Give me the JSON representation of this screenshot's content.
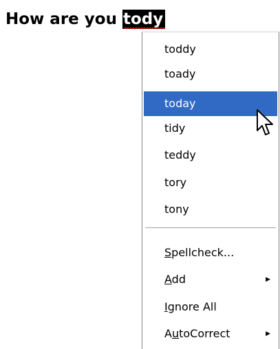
{
  "document": {
    "text_before": "How are you ",
    "misspelled_word": "tody"
  },
  "menu": {
    "suggestions": [
      "toddy",
      "toady",
      "today",
      "tidy",
      "teddy",
      "tory",
      "tony"
    ],
    "selected_index": 2,
    "commands": [
      {
        "pre": "",
        "mnemonic": "S",
        "post": "pellcheck...",
        "submenu": false
      },
      {
        "pre": "",
        "mnemonic": "A",
        "post": "dd",
        "submenu": true
      },
      {
        "pre": "",
        "mnemonic": "I",
        "post": "gnore All",
        "submenu": false
      },
      {
        "pre": "A",
        "mnemonic": "u",
        "post": "toCorrect",
        "submenu": true
      }
    ]
  },
  "colors": {
    "selection": "#316ac5",
    "squiggle": "#ff0000"
  },
  "icons": {
    "submenu_arrow": "triangle-right-icon",
    "cursor": "arrow-pointer-icon"
  }
}
